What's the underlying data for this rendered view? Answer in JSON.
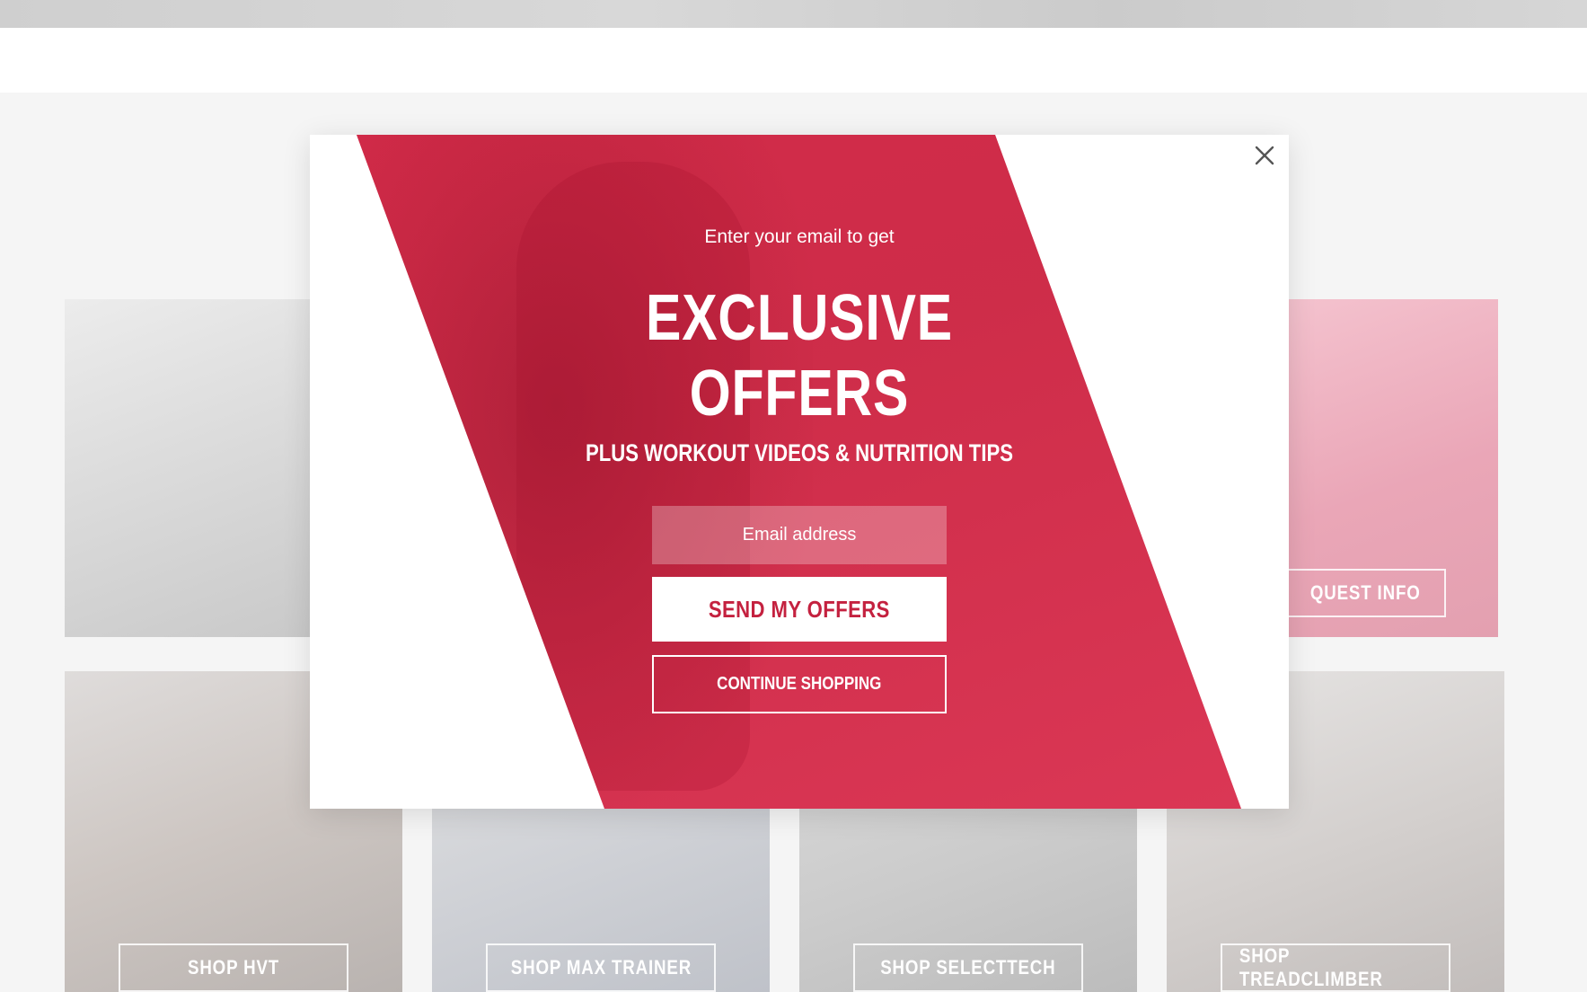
{
  "background": {
    "tiles": [
      {
        "id": "t1",
        "label": ""
      },
      {
        "id": "t2",
        "label": "QUEST INFO"
      },
      {
        "id": "t3",
        "label": "SHOP HVT"
      },
      {
        "id": "t4",
        "label": "SHOP MAX TRAINER"
      },
      {
        "id": "t5",
        "label": "SHOP SELECTTECH"
      },
      {
        "id": "t6",
        "label": "SHOP TREADCLIMBER"
      }
    ]
  },
  "modal": {
    "intro": "Enter your email to get",
    "headline_line1": "EXCLUSIVE",
    "headline_line2": "OFFERS",
    "subhead": "PLUS WORKOUT VIDEOS & NUTRITION TIPS",
    "email_placeholder": "Email address",
    "email_value": "",
    "send_label": "SEND MY OFFERS",
    "continue_label": "CONTINUE SHOPPING",
    "close_icon": "close-icon"
  },
  "colors": {
    "accent_red": "#dc3a58",
    "button_text_red": "#c4213f",
    "white": "#ffffff"
  }
}
